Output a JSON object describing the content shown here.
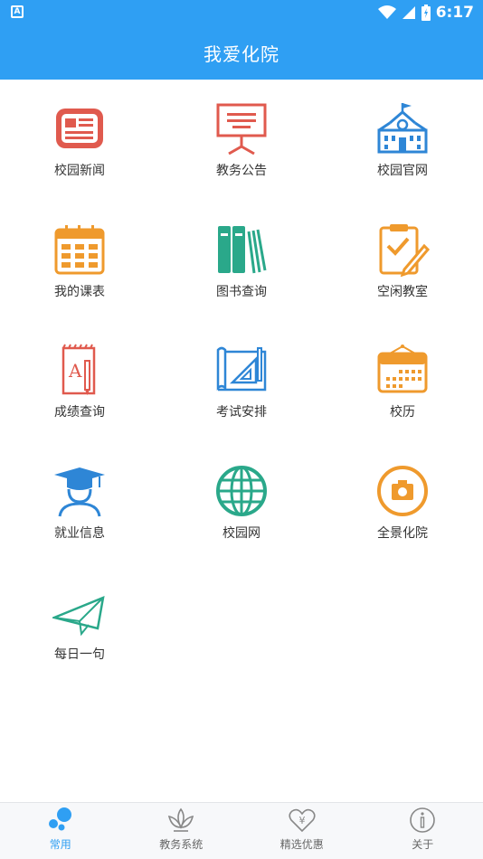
{
  "status": {
    "time": "6:17",
    "icon": "A"
  },
  "header": {
    "title": "我爱化院"
  },
  "tiles": [
    {
      "label": "校园新闻",
      "icon": "newspaper-icon",
      "color": "#e05a4e"
    },
    {
      "label": "教务公告",
      "icon": "easel-board-icon",
      "color": "#e05a4e"
    },
    {
      "label": "校园官网",
      "icon": "school-building-icon",
      "color": "#2e86d6"
    },
    {
      "label": "我的课表",
      "icon": "calendar-icon",
      "color": "#ef9a2d"
    },
    {
      "label": "图书查询",
      "icon": "books-icon",
      "color": "#2aa88a"
    },
    {
      "label": "空闲教室",
      "icon": "clipboard-check-icon",
      "color": "#ef9a2d"
    },
    {
      "label": "成绩查询",
      "icon": "notebook-grade-icon",
      "color": "#e05a4e"
    },
    {
      "label": "考试安排",
      "icon": "ruler-blueprint-icon",
      "color": "#2e86d6"
    },
    {
      "label": "校历",
      "icon": "school-calendar-icon",
      "color": "#ef9a2d"
    },
    {
      "label": "就业信息",
      "icon": "graduate-icon",
      "color": "#2e86d6"
    },
    {
      "label": "校园网",
      "icon": "globe-icon",
      "color": "#2aa88a"
    },
    {
      "label": "全景化院",
      "icon": "camera-icon",
      "color": "#ef9a2d"
    },
    {
      "label": "每日一句",
      "icon": "paper-plane-icon",
      "color": "#2aa88a"
    }
  ],
  "nav": [
    {
      "label": "常用",
      "icon": "bubbles-icon",
      "active": true
    },
    {
      "label": "教务系统",
      "icon": "lotus-icon",
      "active": false
    },
    {
      "label": "精选优惠",
      "icon": "heart-yen-icon",
      "active": false
    },
    {
      "label": "关于",
      "icon": "info-icon",
      "active": false
    }
  ],
  "colors": {
    "primary": "#2f9ff3",
    "red": "#e05a4e",
    "blue": "#2e86d6",
    "orange": "#ef9a2d",
    "green": "#2aa88a"
  }
}
